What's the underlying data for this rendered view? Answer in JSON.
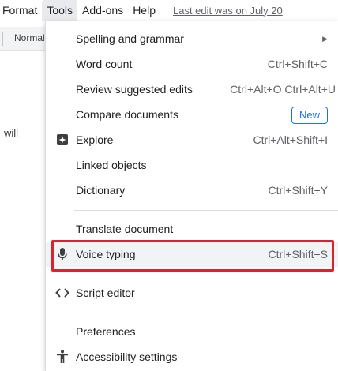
{
  "menubar": {
    "items": [
      "Format",
      "Tools",
      "Add-ons",
      "Help"
    ],
    "last_edit": "Last edit was on July 20"
  },
  "toolbar": {
    "style": "Normal"
  },
  "document": {
    "fragment": "will"
  },
  "tools_menu": {
    "spelling": "Spelling and grammar",
    "word_count": {
      "label": "Word count",
      "shortcut": "Ctrl+Shift+C"
    },
    "review": {
      "label": "Review suggested edits",
      "shortcut": "Ctrl+Alt+O Ctrl+Alt+U"
    },
    "compare": {
      "label": "Compare documents",
      "badge": "New"
    },
    "explore": {
      "label": "Explore",
      "shortcut": "Ctrl+Alt+Shift+I"
    },
    "linked": "Linked objects",
    "dictionary": {
      "label": "Dictionary",
      "shortcut": "Ctrl+Shift+Y"
    },
    "translate": "Translate document",
    "voice": {
      "label": "Voice typing",
      "shortcut": "Ctrl+Shift+S"
    },
    "script": "Script editor",
    "preferences": "Preferences",
    "accessibility": "Accessibility settings"
  },
  "colors": {
    "highlight_border": "#d9232e",
    "badge_blue": "#1a73e8"
  },
  "icons": [
    "explore-icon",
    "microphone-icon",
    "code-brackets-icon",
    "accessibility-icon",
    "submenu-arrow-icon"
  ]
}
